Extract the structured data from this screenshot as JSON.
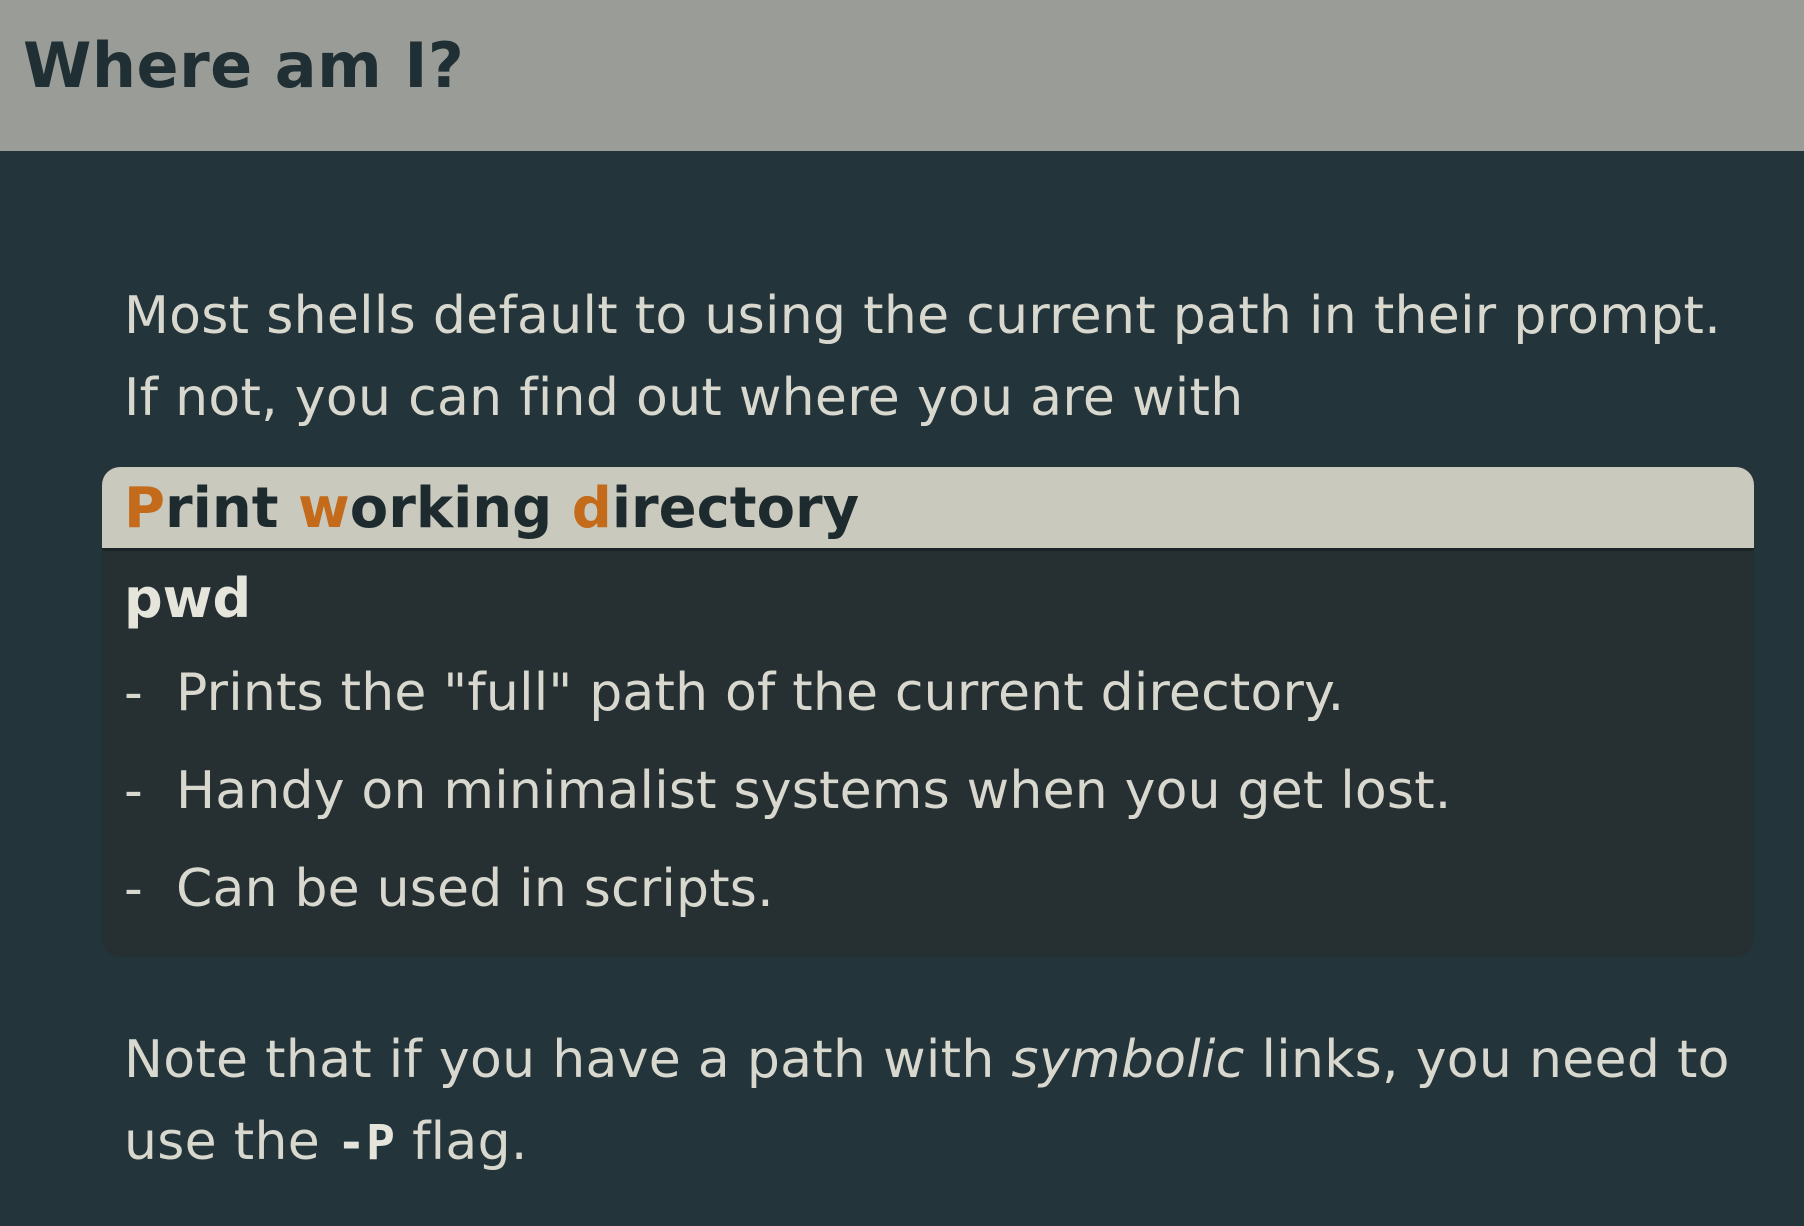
{
  "header": {
    "title": "Where am I?"
  },
  "intro": {
    "text": "Most shells default to using the current path in their prompt. If not, you can find out where you are with"
  },
  "block": {
    "title_parts": [
      {
        "text": "P",
        "accent": true
      },
      {
        "text": "rint ",
        "accent": false
      },
      {
        "text": "w",
        "accent": true
      },
      {
        "text": "orking ",
        "accent": false
      },
      {
        "text": "d",
        "accent": true
      },
      {
        "text": "irectory",
        "accent": false
      }
    ],
    "command": "pwd",
    "bullet_dash": "-",
    "bullets": [
      "Prints the \"full\" path of the current directory.",
      "Handy on minimalist systems when you get lost.",
      "Can be used in scripts."
    ]
  },
  "note": {
    "prefix": "Note that if you have a path with ",
    "emphasis": "symbolic",
    "middle": " links, you need to use the ",
    "flag": "-P",
    "suffix": " flag."
  },
  "colors": {
    "header_bg": "#9a9c97",
    "page_bg": "#23343a",
    "block_bg": "#263033",
    "block_title_bg": "#c9c9be",
    "accent": "#c36b1a"
  }
}
